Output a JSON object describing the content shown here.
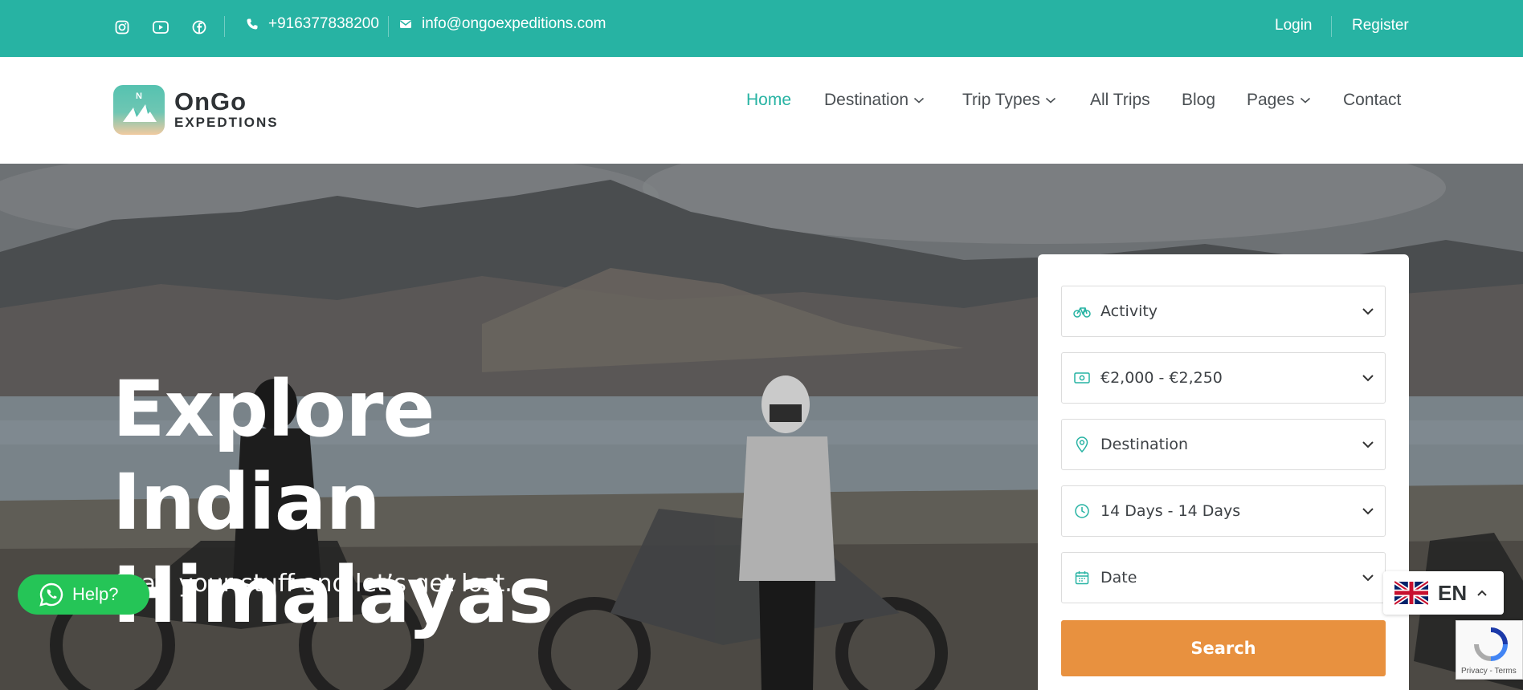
{
  "topbar": {
    "social": [
      {
        "name": "instagram-icon"
      },
      {
        "name": "youtube-icon"
      },
      {
        "name": "facebook-icon"
      }
    ],
    "phone": "+916377838200",
    "email": "info@ongoexpeditions.com",
    "login": "Login",
    "register": "Register"
  },
  "logo": {
    "line1": "OnGo",
    "line2": "EXPEDTIONS",
    "mark_letter": "N"
  },
  "nav": {
    "items": [
      {
        "label": "Home",
        "active": true,
        "dropdown": false
      },
      {
        "label": "Destination",
        "active": false,
        "dropdown": true
      },
      {
        "label": "Trip Types",
        "active": false,
        "dropdown": true
      },
      {
        "label": "All Trips",
        "active": false,
        "dropdown": false
      },
      {
        "label": "Blog",
        "active": false,
        "dropdown": false
      },
      {
        "label": "Pages",
        "active": false,
        "dropdown": true
      },
      {
        "label": "Contact",
        "active": false,
        "dropdown": false
      }
    ]
  },
  "hero": {
    "title": "Explore Indian Himalayas",
    "subtitle": "Grab your stuff and let’s get lost."
  },
  "search": {
    "fields": [
      {
        "icon": "bicycle-icon",
        "value": "Activity"
      },
      {
        "icon": "money-icon",
        "value": "€2,000 - €2,250"
      },
      {
        "icon": "location-pin-icon",
        "value": "Destination"
      },
      {
        "icon": "clock-icon",
        "value": "14 Days - 14 Days"
      },
      {
        "icon": "calendar-icon",
        "value": "Date"
      }
    ],
    "button": "Search"
  },
  "help": {
    "label": "Help?"
  },
  "language": {
    "code": "EN"
  },
  "recaptcha": {
    "text": "Privacy - Terms"
  },
  "colors": {
    "brand_teal": "#27b3a3",
    "search_orange": "#e8913f",
    "whatsapp_green": "#25c557"
  }
}
